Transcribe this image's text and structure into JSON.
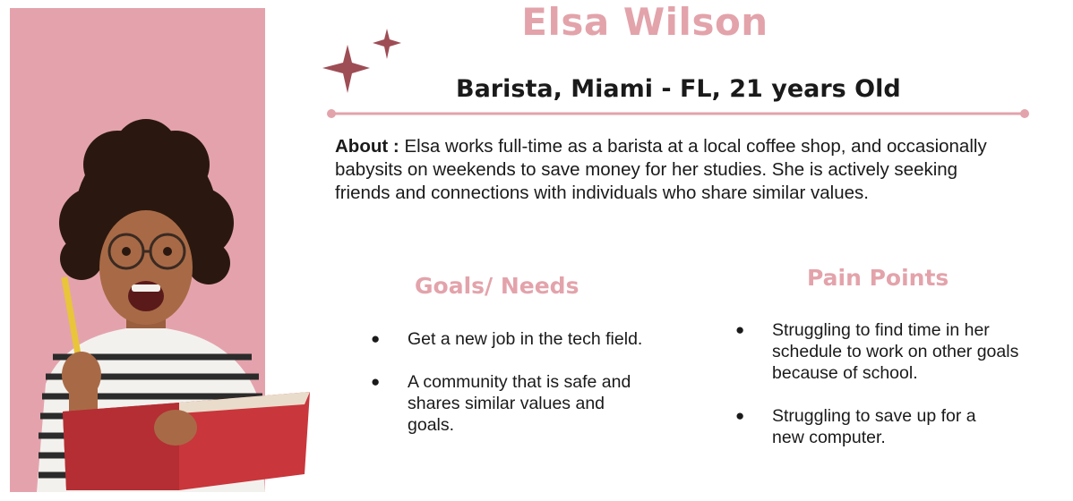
{
  "persona": {
    "name": "Elsa Wilson",
    "subtitle": "Barista, Miami - FL, 21 years Old"
  },
  "about": {
    "label": "About :",
    "text": "Elsa works full-time as a barista at a local coffee shop, and occasionally babysits on weekends to save money for her studies. She is actively seeking friends and connections with individuals who share similar values."
  },
  "goals": {
    "title": "Goals/ Needs",
    "items": [
      "Get a new job in the tech field.",
      "A community that is safe and shares similar values and goals."
    ]
  },
  "pain_points": {
    "title": "Pain Points",
    "items": [
      "Struggling to find time in her schedule to work on other goals because of school.",
      "Struggling to save up for a new computer."
    ]
  },
  "colors": {
    "accent_pink": "#e3a3ab",
    "panel_pink": "#e4a3ac",
    "sparkle": "#9e4d55",
    "text": "#1a1a1a"
  },
  "icons": {
    "sparkle": "sparkle-icon",
    "bullet": "bullet-dot-icon"
  }
}
